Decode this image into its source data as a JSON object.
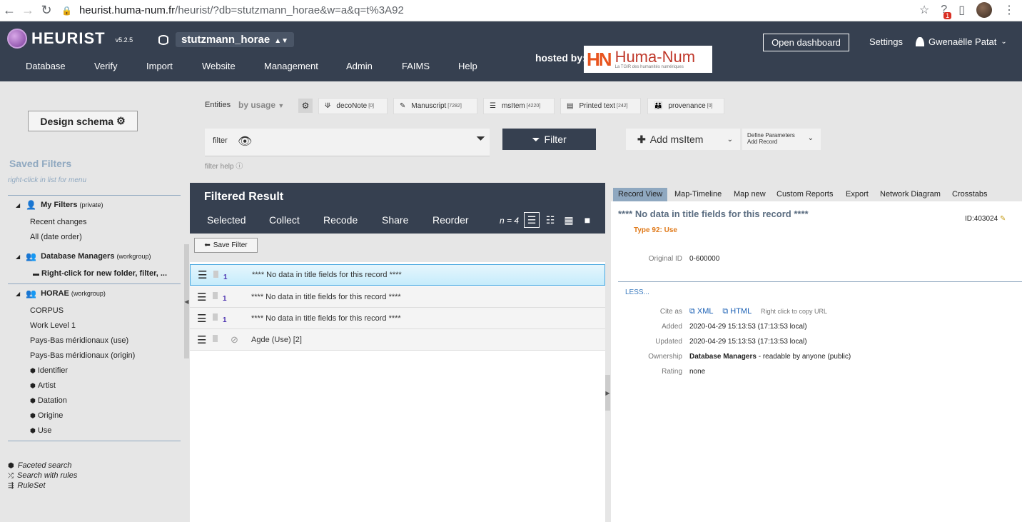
{
  "browser": {
    "url_host": "heurist.huma-num.fr",
    "url_path": "/heurist/?db=stutzmann_horae&w=a&q=t%3A92",
    "badge": "1"
  },
  "header": {
    "logo": "HEURIST",
    "version": "v5.2.5",
    "database": "stutzmann_horae",
    "hosted_by": "hosted by:",
    "partner_logo": "Huma-Num",
    "partner_logo_mark": "HN",
    "partner_tagline": "La TGIR des humanités numériques",
    "menu": [
      "Database",
      "Verify",
      "Import",
      "Website",
      "Management",
      "Admin",
      "FAIMS",
      "Help"
    ],
    "open_dashboard": "Open dashboard",
    "settings": "Settings",
    "user": "Gwenaëlle Patat"
  },
  "left": {
    "design_schema": "Design schema",
    "saved_filters": "Saved Filters",
    "hint": "right-click in list for menu",
    "my_filters": {
      "label": "My Filters",
      "scope": "(private)",
      "items": [
        "Recent changes",
        "All (date order)"
      ]
    },
    "db_managers": {
      "label": "Database Managers",
      "scope": "(workgroup)",
      "items": [
        "Right-click for new folder, filter, ..."
      ]
    },
    "horae": {
      "label": "HORAE",
      "scope": "(workgroup)",
      "items": [
        "CORPUS",
        "Work Level 1",
        "Pays-Bas méridionaux (use)",
        "Pays-Bas méridionaux (origin)",
        "Identifier",
        "Artist",
        "Datation",
        "Origine",
        "Use"
      ]
    },
    "bottom_links": [
      "Faceted search",
      "Search with rules",
      "RuleSet"
    ]
  },
  "toolbar": {
    "entities": "Entities",
    "by_usage": "by usage",
    "entity_buttons": [
      {
        "label": "decoNote",
        "count": "[0]"
      },
      {
        "label": "Manuscript",
        "count": "[7282]"
      },
      {
        "label": "msItem",
        "count": "[4220]"
      },
      {
        "label": "Printed text",
        "count": "[242]"
      },
      {
        "label": "provenance",
        "count": "[0]"
      }
    ],
    "filter_placeholder": "filter",
    "filter_help": "filter help",
    "filter_button": "Filter",
    "add_button": "Add msItem",
    "define_params": "Define Parameters",
    "add_record": "Add Record"
  },
  "results": {
    "title": "Filtered Result",
    "actions": [
      "Selected",
      "Collect",
      "Recode",
      "Share",
      "Reorder"
    ],
    "count": "n = 4",
    "save_filter": "Save Filter",
    "rows": [
      {
        "num": "1",
        "title": "**** No data in title fields for this record ****"
      },
      {
        "num": "1",
        "title": "**** No data in title fields for this record ****"
      },
      {
        "num": "1",
        "title": "**** No data in title fields for this record ****"
      },
      {
        "num": "",
        "title": "Agde (Use) [2]"
      }
    ]
  },
  "record": {
    "tabs": [
      "Record View",
      "Map-Timeline",
      "Map new",
      "Custom Reports",
      "Export",
      "Network Diagram",
      "Crosstabs"
    ],
    "title": "**** No data in title fields for this record ****",
    "id": "ID:403024",
    "type": "Type 92: Use",
    "original_id_label": "Original ID",
    "original_id": "0-600000",
    "less": "LESS...",
    "cite_as_label": "Cite as",
    "xml": "XML",
    "html": "HTML",
    "copy_hint": "Right click to copy URL",
    "added_label": "Added",
    "added": "2020-04-29 15:13:53 (17:13:53 local)",
    "updated_label": "Updated",
    "updated": "2020-04-29 15:13:53 (17:13:53 local)",
    "ownership_label": "Ownership",
    "owner": "Database Managers",
    "ownership_rest": " - readable by anyone (public)",
    "rating_label": "Rating",
    "rating": "none"
  }
}
